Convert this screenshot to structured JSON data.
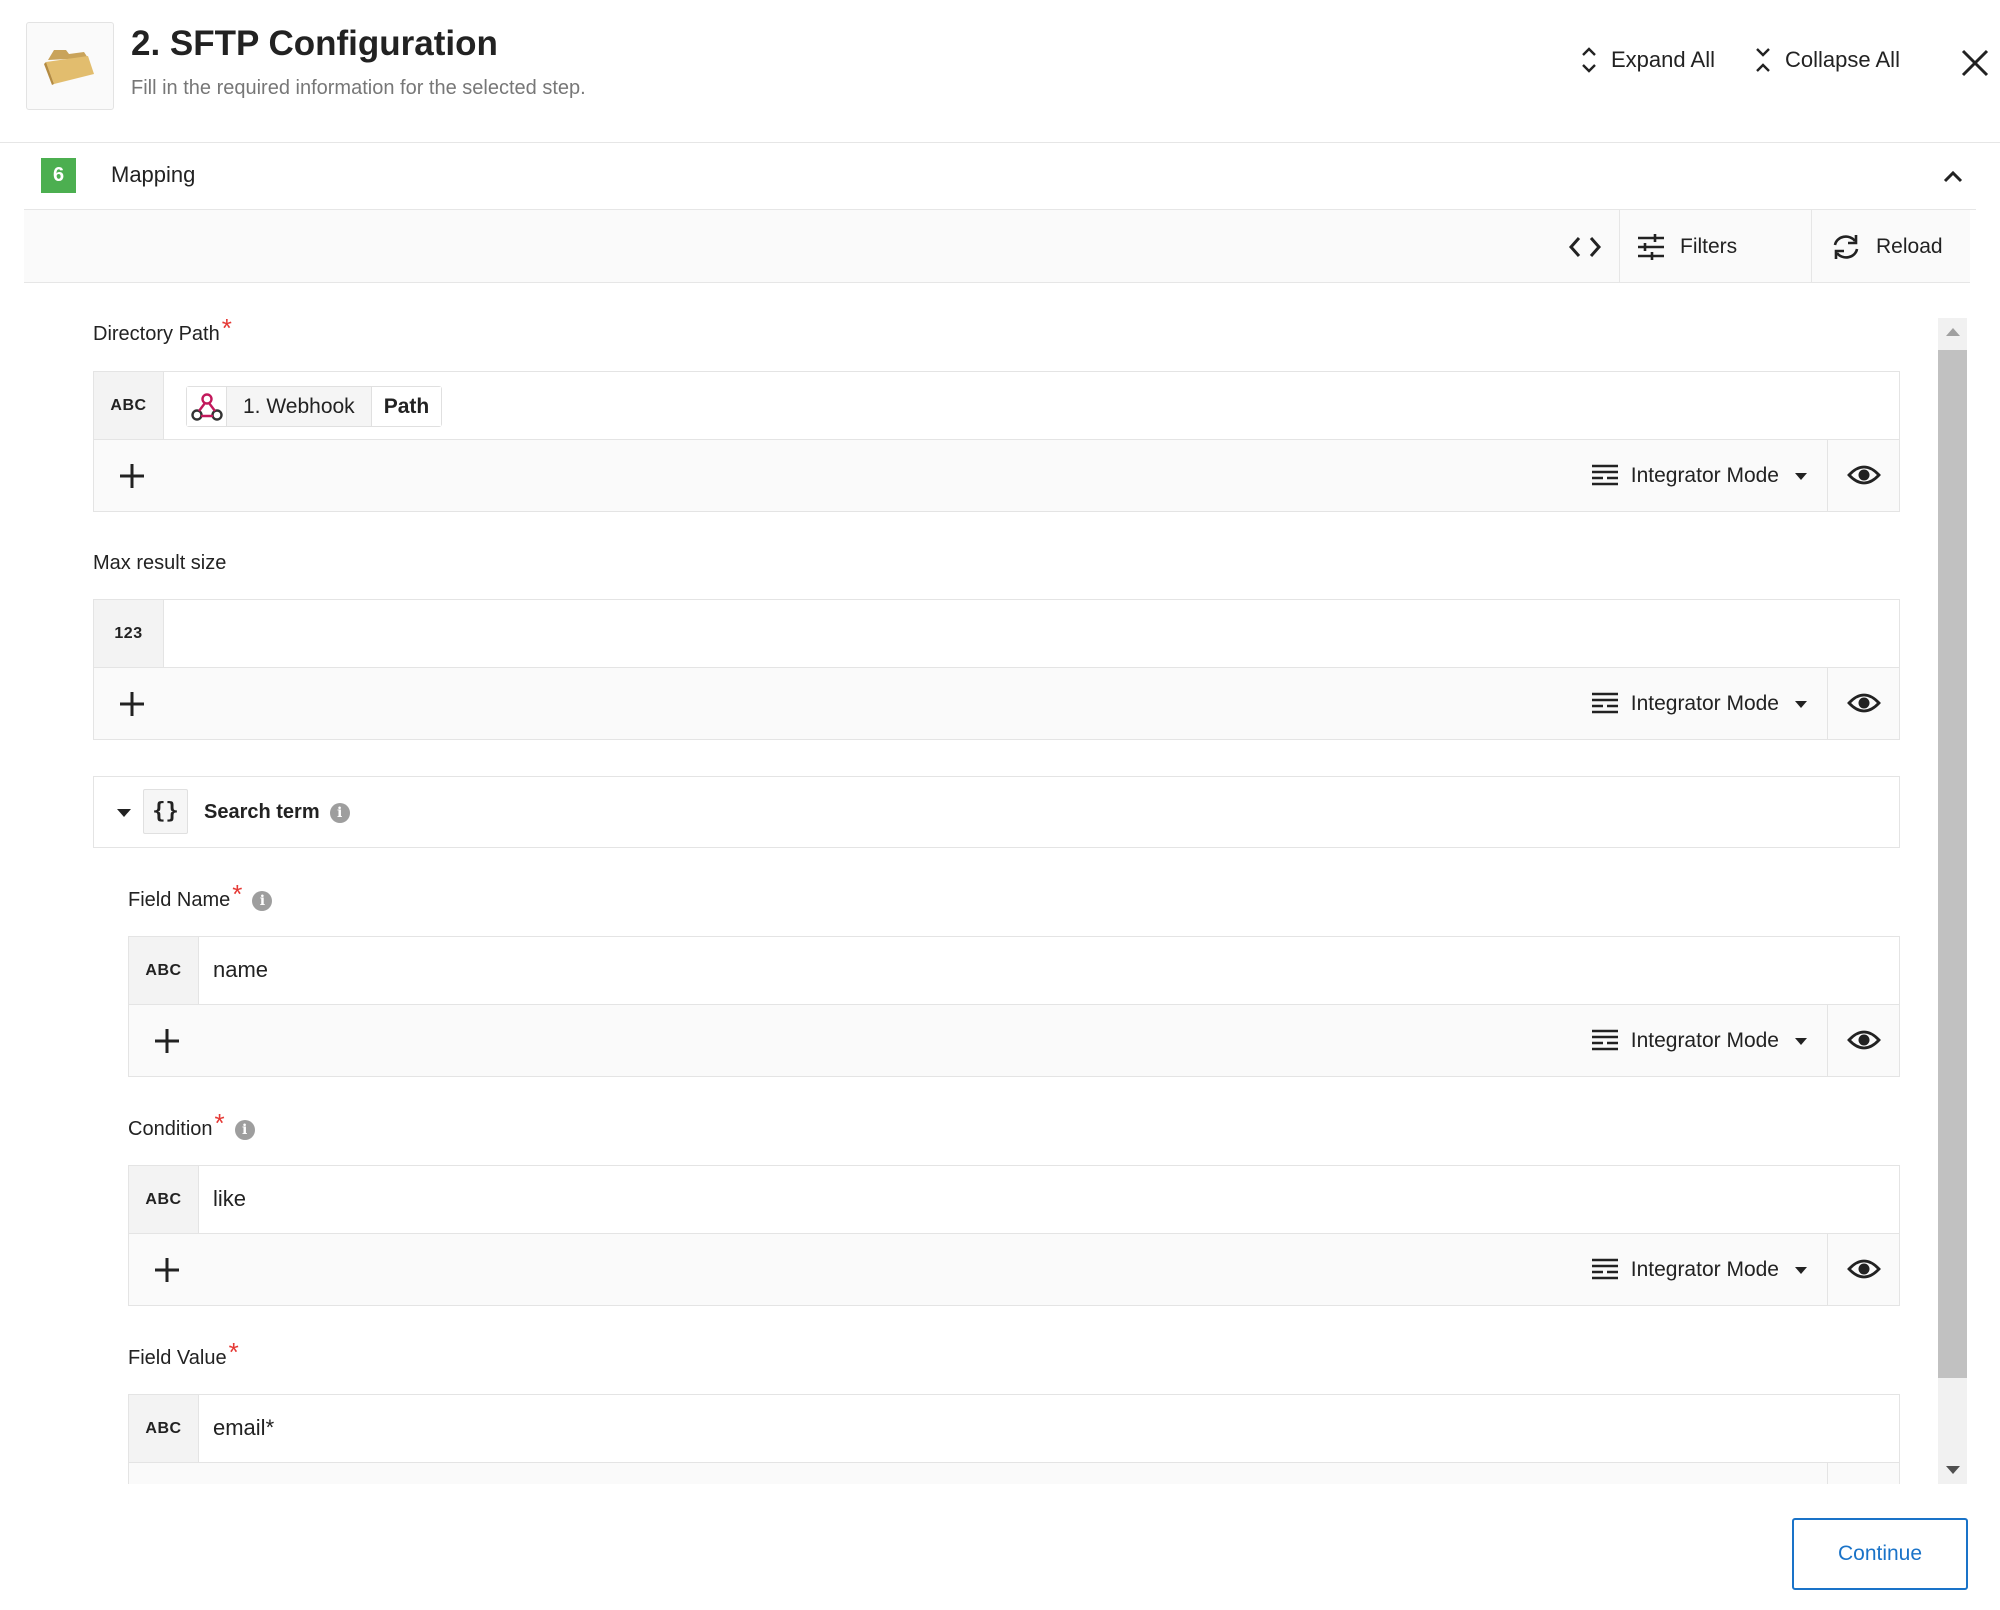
{
  "header": {
    "title": "2. SFTP Configuration",
    "subtitle": "Fill in the required information for the selected step.",
    "expand_all": "Expand All",
    "collapse_all": "Collapse All"
  },
  "section": {
    "step_number": "6",
    "title": "Mapping"
  },
  "toolbar": {
    "filters": "Filters",
    "reload": "Reload"
  },
  "fields": {
    "directory_path": {
      "label": "Directory Path",
      "required": "*",
      "type": "ABC",
      "chip_source": "1. Webhook",
      "chip_field": "Path",
      "mode": "Integrator Mode"
    },
    "max_result_size": {
      "label": "Max result size",
      "type": "123",
      "value": "",
      "mode": "Integrator Mode"
    },
    "search_term": {
      "label": "Search term",
      "info": "i"
    },
    "field_name": {
      "label": "Field Name",
      "required": "*",
      "info": "i",
      "type": "ABC",
      "value": "name",
      "mode": "Integrator Mode"
    },
    "condition": {
      "label": "Condition",
      "required": "*",
      "info": "i",
      "type": "ABC",
      "value": "like",
      "mode": "Integrator Mode"
    },
    "field_value": {
      "label": "Field Value",
      "required": "*",
      "type": "ABC",
      "value": "email*"
    }
  },
  "footer": {
    "continue": "Continue"
  },
  "colors": {
    "accent": "#1a73c8",
    "step_badge": "#4caf50",
    "required": "#e53935"
  }
}
